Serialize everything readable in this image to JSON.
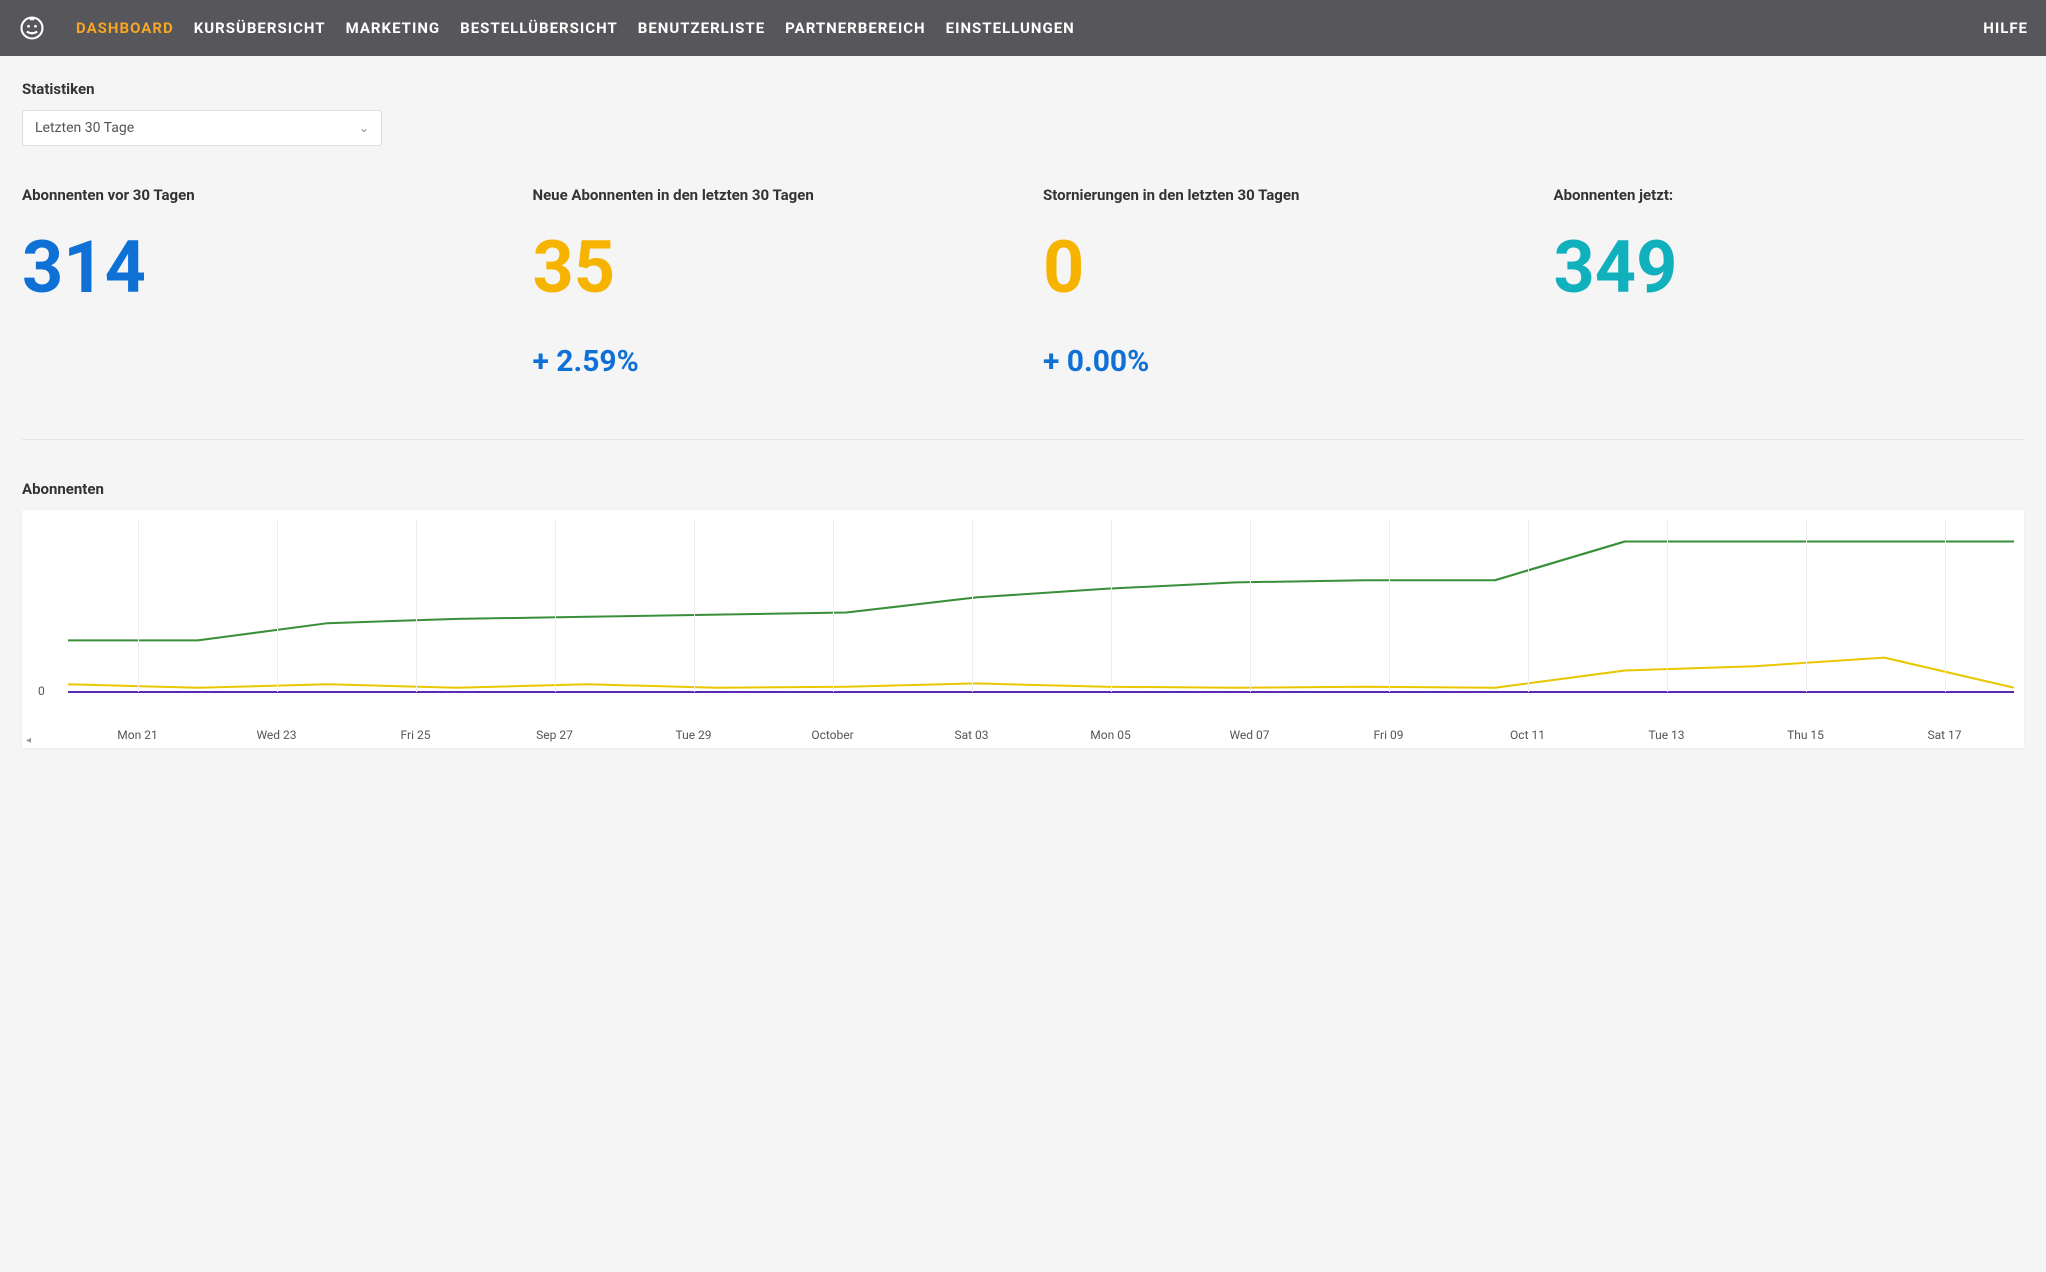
{
  "nav": {
    "items": [
      "DASHBOARD",
      "KURSÜBERSICHT",
      "MARKETING",
      "BESTELLÜBERSICHT",
      "BENUTZERLISTE",
      "PARTNERBEREICH",
      "EINSTELLUNGEN"
    ],
    "active_index": 0,
    "right": [
      "HILFE"
    ]
  },
  "stats_section": {
    "title": "Statistiken",
    "range_selected": "Letzten 30 Tage"
  },
  "stats": [
    {
      "label": "Abonnenten vor 30 Tagen",
      "value": "314",
      "color": "c-blue",
      "delta": ""
    },
    {
      "label": "Neue Abonnenten in den letzten 30 Tagen",
      "value": "35",
      "color": "c-orange",
      "delta": "+ 2.59%"
    },
    {
      "label": "Stornierungen in den letzten 30 Tagen",
      "value": "0",
      "color": "c-orange",
      "delta": "+ 0.00%"
    },
    {
      "label": "Abonnenten jetzt:",
      "value": "349",
      "color": "c-teal",
      "delta": ""
    }
  ],
  "chart": {
    "title": "Abonnenten"
  },
  "chart_data": {
    "type": "line",
    "x_labels": [
      "Mon 21",
      "Wed 23",
      "Fri 25",
      "Sep 27",
      "Tue 29",
      "October",
      "Sat 03",
      "Mon 05",
      "Wed 07",
      "Fri 09",
      "Oct 11",
      "Tue 13",
      "Thu 15",
      "Sat 17"
    ],
    "y_tick": "0",
    "ylim": [
      0,
      400
    ],
    "series": [
      {
        "name": "green",
        "color": "#3a8f3a",
        "values": [
          120,
          120,
          160,
          170,
          175,
          180,
          185,
          220,
          240,
          255,
          260,
          260,
          350,
          350,
          350,
          350
        ]
      },
      {
        "name": "yellow",
        "color": "#e9c700",
        "values": [
          18,
          10,
          18,
          10,
          18,
          10,
          12,
          20,
          12,
          10,
          12,
          10,
          50,
          60,
          80,
          10
        ]
      },
      {
        "name": "purple",
        "color": "#5a2ab5",
        "values": [
          0,
          0,
          0,
          0,
          0,
          0,
          0,
          0,
          0,
          0,
          0,
          0,
          0,
          0,
          0,
          0
        ]
      }
    ]
  }
}
